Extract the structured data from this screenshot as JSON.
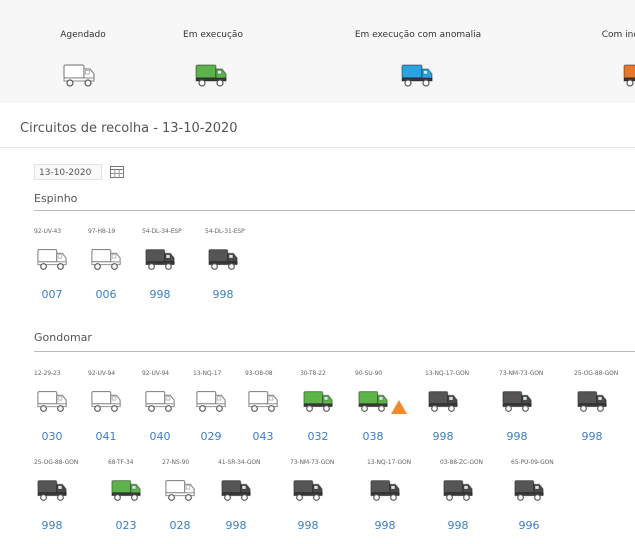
{
  "colors": {
    "scheduled": "#ffffff",
    "running": "#5cb34a",
    "running_anomaly": "#2ca2e0",
    "with_incident": "#e8772e",
    "inactive": "#555555",
    "link": "#3d7fc4",
    "alert": "#f08a2c"
  },
  "legend": [
    {
      "label": "Agendado",
      "status": "scheduled",
      "icon": "truck-outline-icon"
    },
    {
      "label": "Em execução",
      "status": "running",
      "icon": "truck-green-icon"
    },
    {
      "label": "Em execução com anomalia",
      "status": "running_anomaly",
      "icon": "truck-blue-icon"
    },
    {
      "label": "Com inc",
      "status": "with_incident",
      "icon": "truck-orange-icon"
    }
  ],
  "page_title": "Circuitos de recolha - 13-10-2020",
  "date_value": "13-10-2020",
  "groups": [
    {
      "name": "Espinho",
      "trucks": [
        {
          "plate": "92-UV-43",
          "code": "007",
          "status": "scheduled"
        },
        {
          "plate": "97-H8-19",
          "code": "006",
          "status": "scheduled"
        },
        {
          "plate": "54-DL-34-ESP",
          "code": "998",
          "status": "inactive"
        },
        {
          "plate": "54-DL-31-ESP",
          "code": "998",
          "status": "inactive"
        }
      ]
    },
    {
      "name": "Gondomar",
      "trucks": [
        {
          "plate": "12-29-23",
          "code": "030",
          "status": "scheduled"
        },
        {
          "plate": "92-UV-94",
          "code": "041",
          "status": "scheduled"
        },
        {
          "plate": "92-UV-94",
          "code": "040",
          "status": "scheduled"
        },
        {
          "plate": "13-NQ-17",
          "code": "029",
          "status": "scheduled"
        },
        {
          "plate": "93-O8-08",
          "code": "043",
          "status": "scheduled"
        },
        {
          "plate": "30-T8-22",
          "code": "032",
          "status": "running"
        },
        {
          "plate": "90-SU-90",
          "code": "038",
          "status": "running",
          "alert": true
        },
        {
          "plate": "13-NQ-17-GON",
          "code": "998",
          "status": "inactive"
        },
        {
          "plate": "73-NM-73-GON",
          "code": "998",
          "status": "inactive"
        },
        {
          "plate": "25-OG-88-GON",
          "code": "998",
          "status": "inactive"
        },
        {
          "plate": "25-OG-88-GON",
          "code": "998",
          "status": "inactive"
        },
        {
          "plate": "68-TF-34",
          "code": "023",
          "status": "running"
        },
        {
          "plate": "27-NS-90",
          "code": "028",
          "status": "scheduled"
        },
        {
          "plate": "41-SR-34-GON",
          "code": "998",
          "status": "inactive"
        },
        {
          "plate": "73-NM-73-GON",
          "code": "998",
          "status": "inactive"
        },
        {
          "plate": "13-NQ-17-GON",
          "code": "998",
          "status": "inactive"
        },
        {
          "plate": "03-88-ZC-GON",
          "code": "998",
          "status": "inactive"
        },
        {
          "plate": "65-PU-09-GON",
          "code": "996",
          "status": "inactive"
        }
      ]
    }
  ]
}
